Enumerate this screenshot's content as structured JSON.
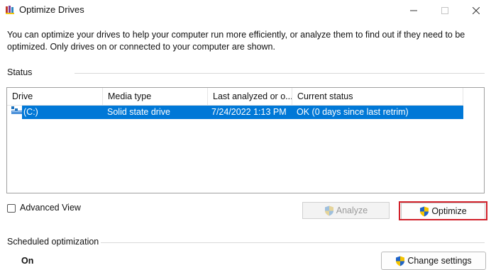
{
  "window": {
    "title": "Optimize Drives",
    "controls": {
      "minimize": "—",
      "maximize": "☐",
      "close": "✕"
    },
    "app_icon": "defrag-app-icon"
  },
  "description": "You can optimize your drives to help your computer run more efficiently, or analyze them to find out if they need to be optimized. Only drives on or connected to your computer are shown.",
  "status_section": {
    "label": "Status",
    "columns": [
      "Drive",
      "Media type",
      "Last analyzed or o...",
      "Current status"
    ],
    "drives": [
      {
        "drive": "(C:)",
        "media_type": "Solid state drive",
        "last_analyzed": "7/24/2022 1:13 PM",
        "current_status": "OK (0 days since last retrim)",
        "selected": true,
        "icon": "drive-icon"
      }
    ]
  },
  "advanced_view": {
    "label": "Advanced View",
    "checked": false
  },
  "buttons": {
    "analyze": "Analyze",
    "optimize": "Optimize",
    "change_settings": "Change settings",
    "shield_icon": "uac-shield-icon"
  },
  "scheduled": {
    "label": "Scheduled optimization",
    "status": "On"
  },
  "colors": {
    "selection": "#0078d7",
    "highlight_box": "#d1202a",
    "disabled_text": "#9a9a9a"
  }
}
